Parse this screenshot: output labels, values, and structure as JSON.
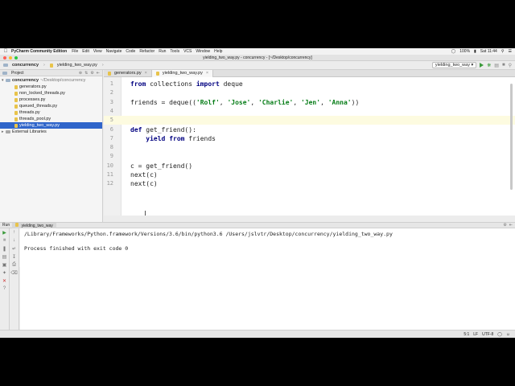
{
  "menubar": {
    "app": "PyCharm Community Edition",
    "items": [
      "File",
      "Edit",
      "View",
      "Navigate",
      "Code",
      "Refactor",
      "Run",
      "Tools",
      "VCS",
      "Window",
      "Help"
    ],
    "battery": "100%",
    "clock": "Sat 11:44"
  },
  "window": {
    "title": "yielding_two_way.py - concurrency - [~/Desktop/concurrency]"
  },
  "navbar": {
    "project": "concurrency",
    "file": "yielding_two_way.py",
    "run_config": "yielding_two_way"
  },
  "project_panel": {
    "title": "Project",
    "root": "concurrency",
    "root_path": "~/Desktop/concurrency",
    "files": [
      "generators.py",
      "non_locked_threads.py",
      "processes.py",
      "queued_threads.py",
      "threads.py",
      "threads_pool.py",
      "yielding_two_way.py"
    ],
    "external": "External Libraries"
  },
  "tabs": [
    {
      "label": "generators.py"
    },
    {
      "label": "yielding_two_way.py"
    }
  ],
  "editor": {
    "lines": [
      {
        "num": "1",
        "tokens": [
          {
            "t": "from",
            "c": "kw"
          },
          {
            "t": " collections "
          },
          {
            "t": "import",
            "c": "kw"
          },
          {
            "t": " deque"
          }
        ]
      },
      {
        "num": "2",
        "tokens": []
      },
      {
        "num": "3",
        "tokens": [
          {
            "t": "friends = deque(("
          },
          {
            "t": "'Rolf'",
            "c": "str"
          },
          {
            "t": ", "
          },
          {
            "t": "'Jose'",
            "c": "str"
          },
          {
            "t": ", "
          },
          {
            "t": "'Charlie'",
            "c": "str"
          },
          {
            "t": ", "
          },
          {
            "t": "'Jen'",
            "c": "str"
          },
          {
            "t": ", "
          },
          {
            "t": "'Anna'",
            "c": "str"
          },
          {
            "t": "))"
          }
        ]
      },
      {
        "num": "4",
        "tokens": []
      },
      {
        "num": "5",
        "tokens": [],
        "current": true
      },
      {
        "num": "6",
        "tokens": [
          {
            "t": "def",
            "c": "kw"
          },
          {
            "t": " get_friend():"
          }
        ]
      },
      {
        "num": "7",
        "tokens": [
          {
            "t": "    "
          },
          {
            "t": "yield",
            "c": "kw"
          },
          {
            "t": " "
          },
          {
            "t": "from",
            "c": "kw"
          },
          {
            "t": " friends"
          }
        ]
      },
      {
        "num": "8",
        "tokens": []
      },
      {
        "num": "9",
        "tokens": []
      },
      {
        "num": "10",
        "tokens": [
          {
            "t": "c = get_friend()"
          }
        ]
      },
      {
        "num": "11",
        "tokens": [
          {
            "t": "next(c)"
          }
        ]
      },
      {
        "num": "12",
        "tokens": [
          {
            "t": "next(c)"
          }
        ]
      }
    ]
  },
  "run_panel": {
    "label": "Run",
    "tab": "yielding_two_way",
    "output": [
      "/Library/Frameworks/Python.framework/Versions/3.6/bin/python3.6 /Users/jslvtr/Desktop/concurrency/yielding_two_way.py",
      "",
      "Process finished with exit code 0"
    ]
  },
  "status": {
    "position": "5:1",
    "line_sep": "LF",
    "encoding": "UTF-8"
  }
}
